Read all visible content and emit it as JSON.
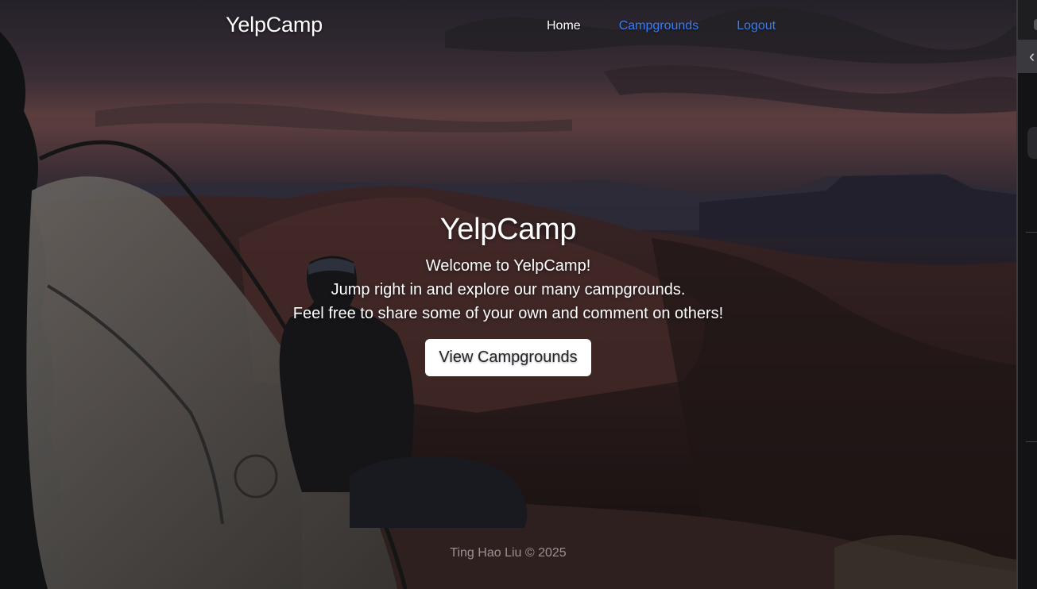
{
  "brand": {
    "name": "YelpCamp"
  },
  "nav": {
    "home": "Home",
    "campgrounds": "Campgrounds",
    "logout": "Logout"
  },
  "hero": {
    "title": "YelpCamp",
    "lines": [
      "Welcome to YelpCamp!",
      "Jump right in and explore our many campgrounds.",
      "Feel free to share some of your own and comment on others!"
    ],
    "cta": "View Campgrounds"
  },
  "footer": {
    "text": "Ting Hao Liu © 2025"
  },
  "side_panel": {
    "chevron_icon": "chevron-left-icon"
  },
  "colors": {
    "link_active": "#ffffff",
    "link": "#3b7ef5",
    "button_bg": "#ffffff",
    "button_text": "#212529",
    "footer_text": "rgba(255,255,255,0.5)"
  }
}
